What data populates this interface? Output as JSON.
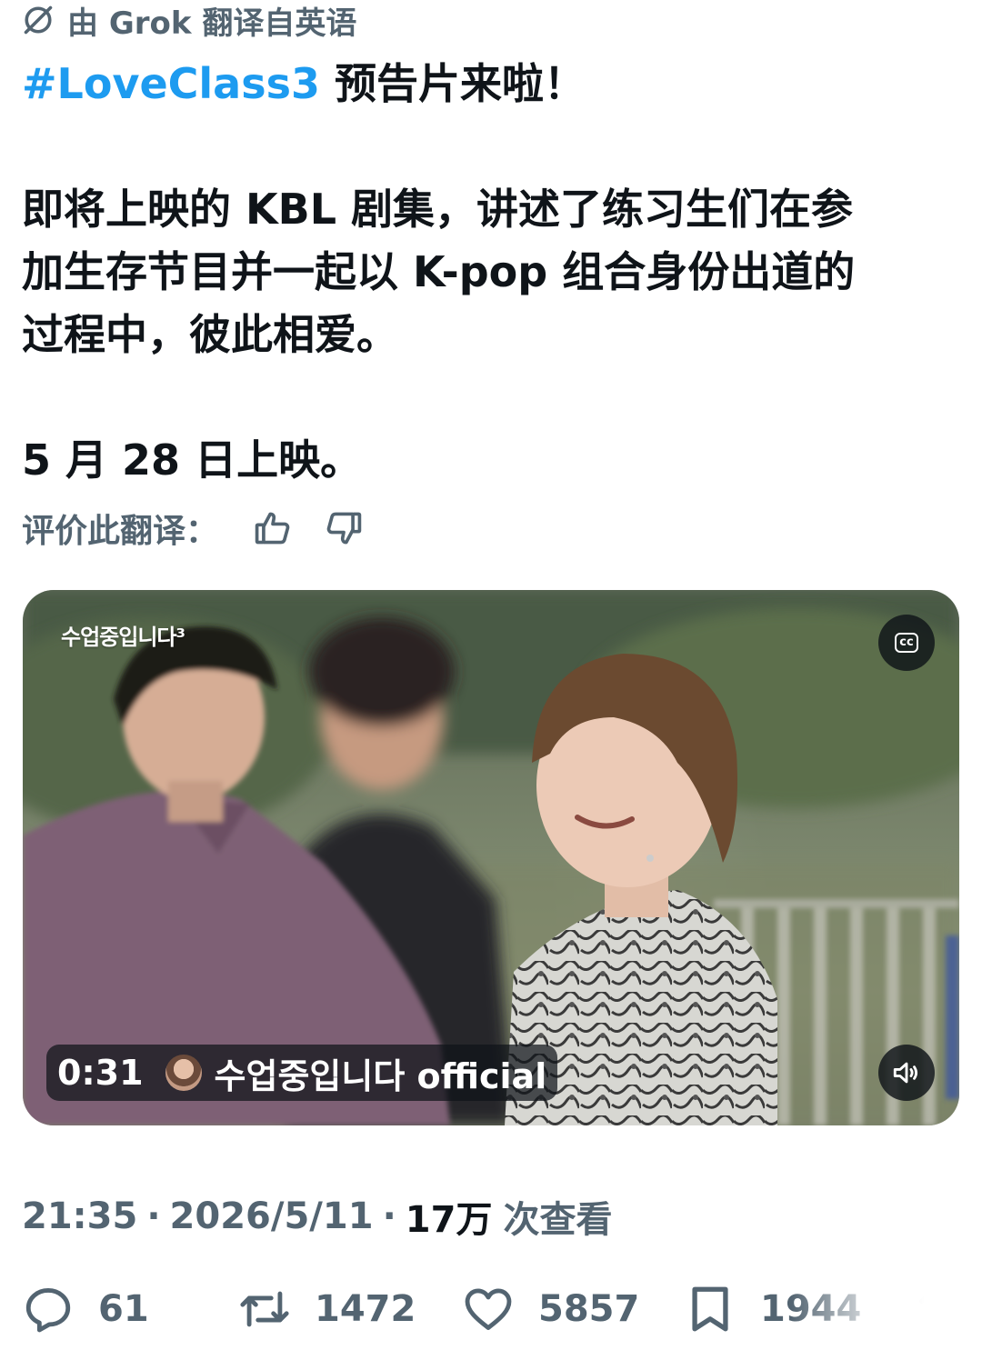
{
  "translation_note": "由 Grok 翻译自英语",
  "tweet": {
    "hashtag": "#LoveClass3",
    "headline_rest": " 预告片来啦！",
    "body_line1": "即将上映的 KBL 剧集，讲述了练习生们在参",
    "body_line2": "加生存节目并一起以 K-pop 组合身份出道的",
    "body_line3": "过程中，彼此相爱。",
    "release": "5 月 28 日上映。"
  },
  "rate_translation": {
    "label": "评价此翻译：",
    "up_icon": "thumbs-up-icon",
    "down_icon": "thumbs-down-icon"
  },
  "video": {
    "brand_overlay": "수업중입니다³",
    "timestamp": "0:31",
    "channel": "수업중입니다 official",
    "cc_label": "cc",
    "volume_icon": "volume-icon"
  },
  "meta": {
    "time": "21:35",
    "separator": "·",
    "date": "2026/5/11",
    "views_count": "17万",
    "views_label": "次查看"
  },
  "actions": {
    "replies": "61",
    "retweets": "1472",
    "likes": "5857",
    "bookmarks": "1944"
  },
  "colors": {
    "link": "#1d9bf0",
    "secondary": "#536471",
    "primary": "#0f1419"
  }
}
